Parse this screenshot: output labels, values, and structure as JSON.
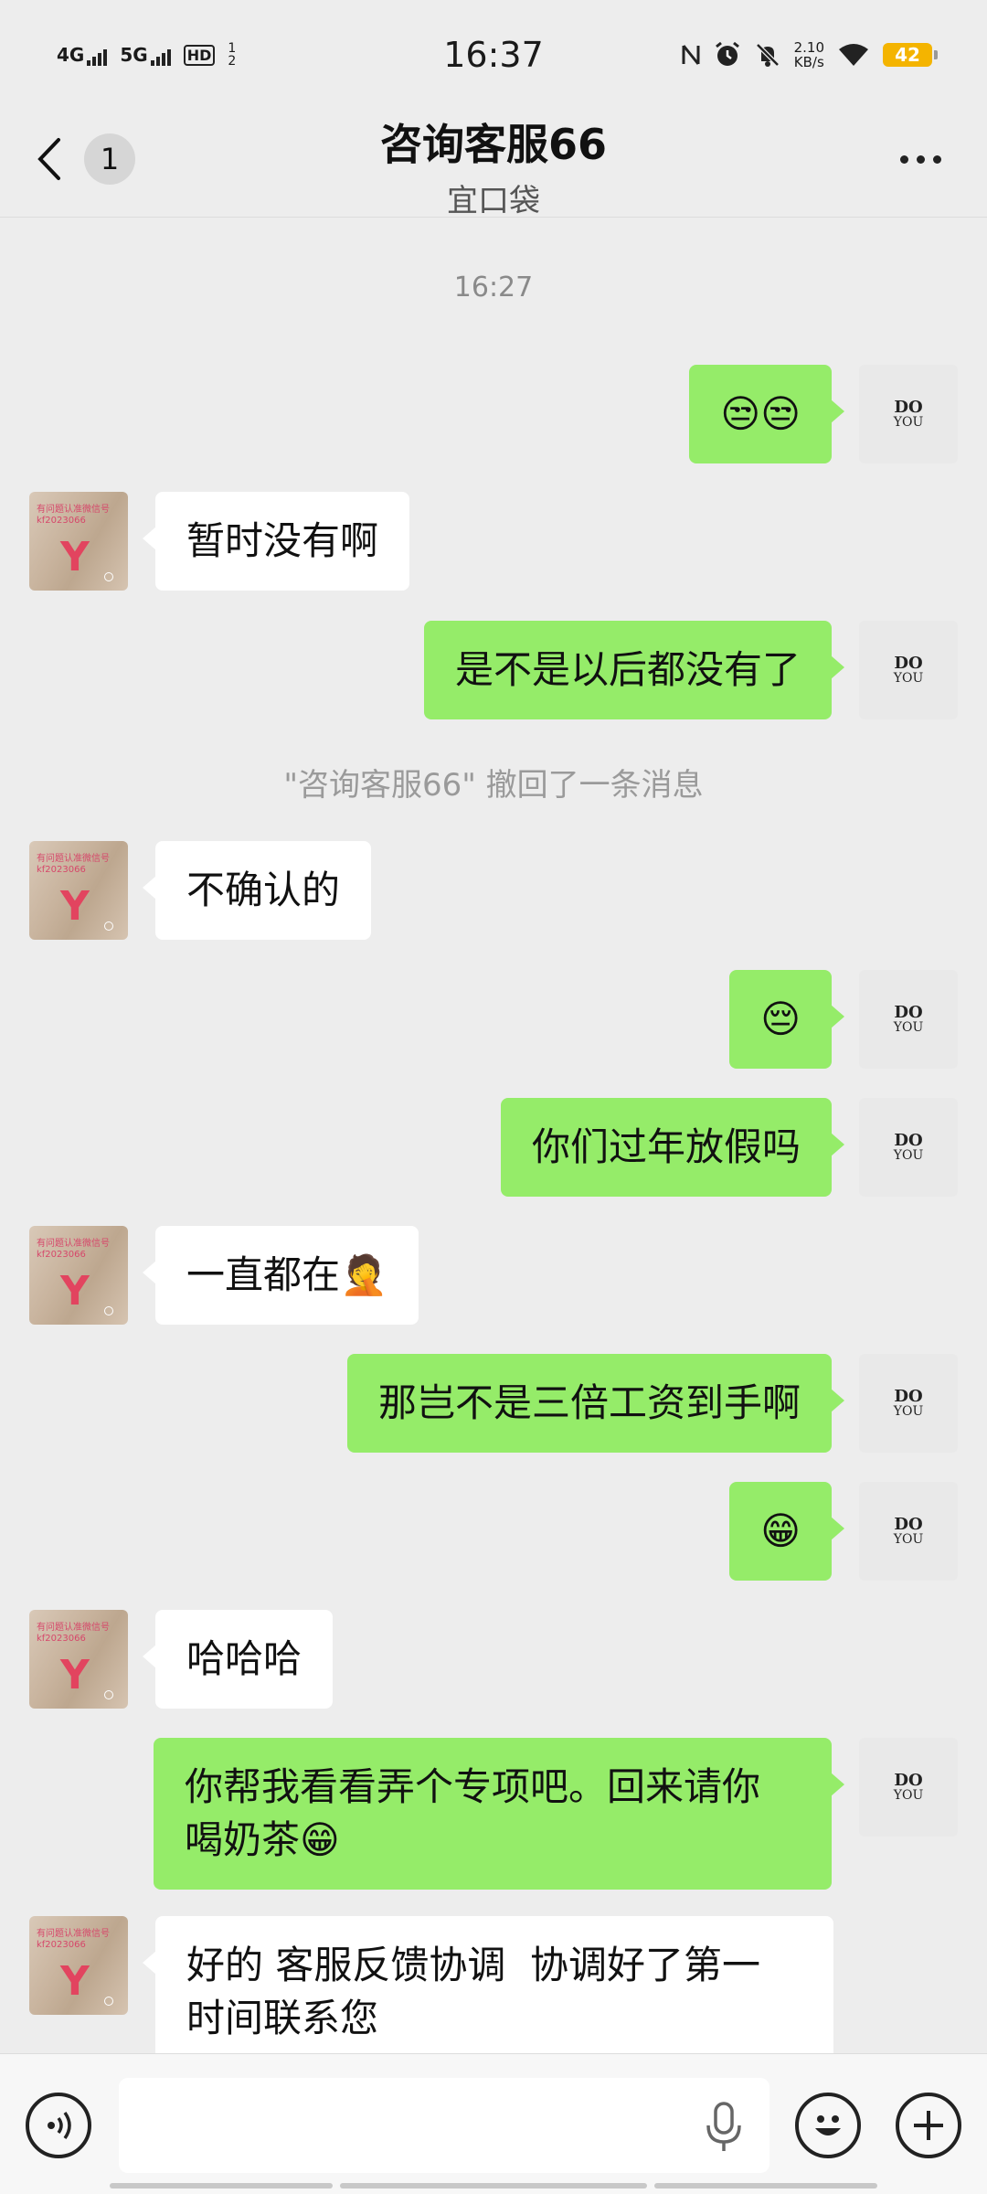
{
  "status_bar": {
    "time": "16:37",
    "net1": "4G",
    "net2": "5G",
    "hd": "HD",
    "hd_sub": "1 2",
    "speed_value": "2.10",
    "speed_unit": "KB/s",
    "battery": "42",
    "icons": [
      "nfc-icon",
      "alarm-icon",
      "mute-icon",
      "wifi-icon"
    ]
  },
  "header": {
    "unread_count": "1",
    "title": "咨询客服66",
    "subtitle": "宜口袋"
  },
  "me_avatar": {
    "line1": "DO",
    "line2": "YOU"
  },
  "cs_avatar": {
    "letter": "Y",
    "caption": "有问题认准微信号 kf2023066"
  },
  "messages": [
    {
      "type": "time",
      "text": "16:27"
    },
    {
      "type": "me",
      "text": "😒😒"
    },
    {
      "type": "cs",
      "text": "暂时没有啊"
    },
    {
      "type": "me",
      "text": "是不是以后都没有了"
    },
    {
      "type": "system",
      "text": "\"咨询客服66\" 撤回了一条消息"
    },
    {
      "type": "cs",
      "text": "不确认的"
    },
    {
      "type": "me",
      "text": "😔"
    },
    {
      "type": "me",
      "text": "你们过年放假吗"
    },
    {
      "type": "cs",
      "text": "一直都在🤦"
    },
    {
      "type": "me",
      "text": "那岂不是三倍工资到手啊"
    },
    {
      "type": "me",
      "text": "😁"
    },
    {
      "type": "cs",
      "text": "哈哈哈"
    },
    {
      "type": "me",
      "text": "你帮我看看弄个专项吧。回来请你\n喝奶茶😁"
    },
    {
      "type": "cs",
      "text": "好的 客服反馈协调  协调好了第一\n时间联系您"
    }
  ],
  "input": {
    "placeholder": ""
  },
  "colors": {
    "me_bubble": "#95ec69",
    "cs_bubble": "#ffffff",
    "background": "#ededed"
  }
}
